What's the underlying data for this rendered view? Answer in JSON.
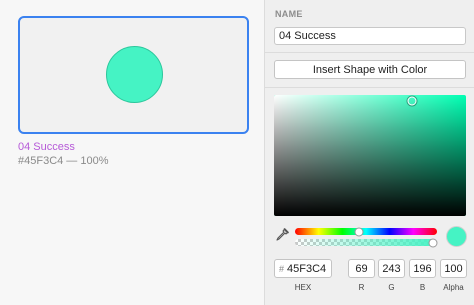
{
  "swatch": {
    "name": "04 Success",
    "subtitle": "#45F3C4 — 100%",
    "color": "#45F3C4"
  },
  "inspector": {
    "name_label": "NAME",
    "name_value": "04 Success",
    "insert_button": "Insert Shape with Color",
    "eyedropper_icon": "eyedropper-icon",
    "hue_fraction": 0.45,
    "alpha_fraction": 1.0,
    "picker_saturation_fraction": 0.72,
    "picker_brightness_fraction": 0.95,
    "fields": {
      "hex": {
        "value": "45F3C4",
        "label": "HEX",
        "prefix": "#"
      },
      "r": {
        "value": "69",
        "label": "R"
      },
      "g": {
        "value": "243",
        "label": "G"
      },
      "b": {
        "value": "196",
        "label": "B"
      },
      "alpha": {
        "value": "100",
        "label": "Alpha"
      }
    }
  },
  "colors": {
    "accent": "#3B82F0",
    "swatch_name": "#B65AD8",
    "hue_color": "#00FFB3"
  }
}
